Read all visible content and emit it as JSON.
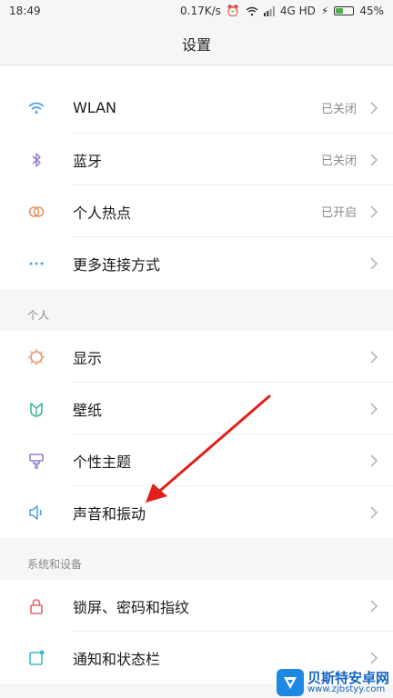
{
  "status_bar": {
    "time": "18:49",
    "speed": "0.17K/s",
    "network": "4G HD",
    "battery": "45%",
    "battery_level": 0.45
  },
  "title": "设置",
  "connectivity": [
    {
      "label": "WLAN",
      "value": "已关闭",
      "icon": "wifi-icon",
      "color": "#4aa3df"
    },
    {
      "label": "蓝牙",
      "value": "已关闭",
      "icon": "bluetooth-icon",
      "color": "#9b7fc9"
    },
    {
      "label": "个人热点",
      "value": "已开启",
      "icon": "hotspot-icon",
      "color": "#e8956a"
    },
    {
      "label": "更多连接方式",
      "value": "",
      "icon": "more-dots-icon",
      "color": "#4aa3df"
    }
  ],
  "personal_header": "个人",
  "personal": [
    {
      "label": "显示",
      "icon": "sun-icon",
      "color": "#e8956a"
    },
    {
      "label": "壁纸",
      "icon": "wallpaper-icon",
      "color": "#3fb8a0"
    },
    {
      "label": "个性主题",
      "icon": "theme-brush-icon",
      "color": "#9b7fc9"
    },
    {
      "label": "声音和振动",
      "icon": "speaker-icon",
      "color": "#4aa3df"
    }
  ],
  "system_header": "系统和设备",
  "system": [
    {
      "label": "锁屏、密码和指纹",
      "icon": "lock-icon",
      "color": "#e2656d"
    },
    {
      "label": "通知和状态栏",
      "icon": "notification-icon",
      "color": "#3fb8c9"
    }
  ],
  "watermark": {
    "main": "贝斯特安卓网",
    "sub": "www.zjbstyy.com"
  },
  "colors": {
    "annotation_arrow": "#e0201c"
  }
}
